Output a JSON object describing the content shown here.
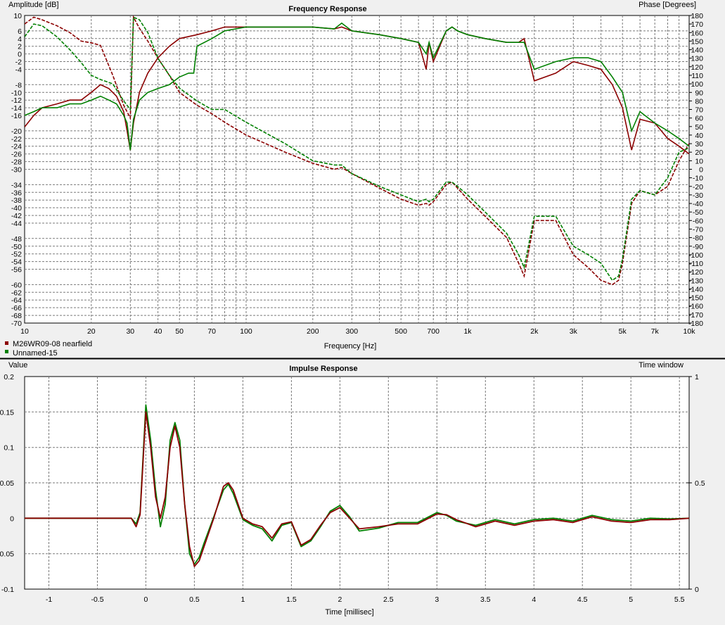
{
  "chart_data": [
    {
      "type": "line",
      "title": "Frequency Response",
      "xlabel": "Frequency [Hz]",
      "ylabel": "Amplitude [dB]",
      "y2label": "Phase [Degrees]",
      "xscale": "log",
      "xlim": [
        10,
        10000
      ],
      "ylim": [
        -70,
        10
      ],
      "y2lim": [
        -180,
        180
      ],
      "grid": true,
      "legend": "bottom-left",
      "xtick_values": [
        10,
        20,
        30,
        40,
        50,
        70,
        100,
        200,
        300,
        500,
        700,
        1000,
        2000,
        3000,
        5000,
        7000,
        10000
      ],
      "xtick_labels": [
        "10",
        "20",
        "30",
        "40",
        "50",
        "70",
        "100",
        "200",
        "300",
        "500",
        "700",
        "1k",
        "2k",
        "3k",
        "5k",
        "7k",
        "10k"
      ],
      "ytick_values": [
        10,
        6,
        4,
        2,
        0,
        -2,
        -4,
        -8,
        -10,
        -12,
        -14,
        -16,
        -20,
        -22,
        -24,
        -26,
        -28,
        -30,
        -34,
        -36,
        -38,
        -40,
        -42,
        -44,
        -48,
        -50,
        -52,
        -54,
        -56,
        -60,
        -62,
        -64,
        -66,
        -68,
        -70
      ],
      "ytick_labels": [
        "10",
        "6",
        "4",
        "2",
        "0",
        "-2",
        "-4",
        "-8",
        "-10",
        "-12",
        "-14",
        "-16",
        "-20",
        "-22",
        "-24",
        "-26",
        "-28",
        "-30",
        "-34",
        "-36",
        "-38",
        "-40",
        "-42",
        "-44",
        "-48",
        "-50",
        "-52",
        "-54",
        "-56",
        "-60",
        "-62",
        "-64",
        "-66",
        "-68",
        "-70"
      ],
      "y2tick_values": [
        180,
        170,
        160,
        150,
        140,
        130,
        120,
        110,
        100,
        90,
        80,
        70,
        60,
        50,
        40,
        30,
        20,
        10,
        0,
        -10,
        -20,
        -30,
        -40,
        -50,
        -60,
        -70,
        -80,
        -90,
        -100,
        -110,
        -120,
        -130,
        -140,
        -150,
        -160,
        -170,
        -180
      ],
      "series": [
        {
          "name": "M26WR09-08 nearfield",
          "kind": "amplitude",
          "color": "#8b0000",
          "x": [
            10,
            11,
            12,
            14,
            16,
            18,
            20,
            22,
            24,
            26,
            28,
            29,
            30,
            31,
            33,
            36,
            40,
            45,
            50,
            60,
            70,
            80,
            100,
            150,
            200,
            250,
            270,
            300,
            400,
            500,
            600,
            650,
            670,
            700,
            800,
            850,
            900,
            1000,
            1200,
            1500,
            1700,
            1800,
            2000,
            2500,
            3000,
            3500,
            4000,
            4500,
            5000,
            5500,
            6000,
            7000,
            8000,
            9000,
            10000
          ],
          "y": [
            -19,
            -16,
            -14,
            -13,
            -12,
            -12,
            -10,
            -8,
            -9,
            -11,
            -15,
            -20,
            -25,
            -18,
            -10,
            -5,
            -1,
            2,
            4,
            5,
            6,
            7,
            7,
            7,
            7,
            6.5,
            7,
            6,
            5,
            4,
            3,
            -4,
            3,
            -2,
            6,
            7,
            6,
            5,
            4,
            3,
            3,
            4,
            -7,
            -5,
            -2,
            -3,
            -4,
            -8,
            -14,
            -25,
            -17,
            -18,
            -22,
            -24,
            -26
          ]
        },
        {
          "name": "M26WR09-08 nearfield",
          "kind": "phase",
          "color": "#8b0000",
          "x": [
            10,
            11,
            12,
            14,
            16,
            18,
            20,
            22,
            25,
            28,
            30,
            31,
            33,
            36,
            40,
            45,
            50,
            60,
            70,
            80,
            100,
            150,
            200,
            250,
            270,
            300,
            400,
            500,
            600,
            650,
            670,
            700,
            800,
            850,
            900,
            1000,
            1200,
            1500,
            1700,
            1800,
            2000,
            2500,
            3000,
            3500,
            4000,
            4500,
            4800,
            5000,
            5500,
            6000,
            7000,
            8000,
            9000,
            10000
          ],
          "y": [
            170,
            178,
            175,
            168,
            160,
            150,
            148,
            145,
            110,
            75,
            60,
            178,
            165,
            150,
            130,
            110,
            90,
            75,
            65,
            55,
            40,
            20,
            7,
            0,
            2,
            -5,
            -22,
            -35,
            -42,
            -40,
            -42,
            -38,
            -18,
            -15,
            -22,
            -35,
            -55,
            -80,
            -110,
            -125,
            -60,
            -60,
            -100,
            -115,
            -130,
            -135,
            -130,
            -110,
            -40,
            -25,
            -30,
            -20,
            10,
            30
          ]
        },
        {
          "name": "Unnamed-15",
          "kind": "amplitude",
          "color": "#008000",
          "x": [
            10,
            11,
            12,
            14,
            16,
            18,
            20,
            22,
            24,
            26,
            28,
            29,
            30,
            31,
            33,
            36,
            40,
            45,
            50,
            55,
            58,
            60,
            70,
            80,
            100,
            150,
            200,
            250,
            270,
            300,
            400,
            500,
            600,
            650,
            670,
            700,
            800,
            850,
            900,
            1000,
            1200,
            1500,
            1700,
            1800,
            2000,
            2500,
            3000,
            3500,
            4000,
            4500,
            5000,
            5500,
            6000,
            7000,
            8000,
            9000,
            10000
          ],
          "y": [
            -16,
            -15,
            -14,
            -14,
            -13,
            -13,
            -12,
            -11,
            -12,
            -13,
            -16,
            -18,
            -25,
            -17,
            -12,
            -10,
            -9,
            -8,
            -6,
            -5,
            -5,
            2,
            4,
            6,
            7,
            7,
            7,
            6.5,
            8,
            6,
            5,
            4,
            3,
            0,
            3,
            -1,
            6,
            7,
            6,
            5,
            4,
            3,
            3,
            3,
            -4,
            -2,
            -1,
            -1,
            -2,
            -6,
            -10,
            -20,
            -15,
            -18,
            -20,
            -22,
            -24
          ]
        },
        {
          "name": "Unnamed-15",
          "kind": "phase",
          "color": "#008000",
          "x": [
            10,
            11,
            12,
            14,
            16,
            18,
            20,
            22,
            25,
            28,
            30,
            31,
            33,
            36,
            40,
            45,
            50,
            60,
            70,
            80,
            100,
            150,
            200,
            250,
            270,
            300,
            400,
            500,
            600,
            650,
            670,
            700,
            800,
            850,
            900,
            1000,
            1200,
            1500,
            1700,
            1800,
            2000,
            2500,
            3000,
            3500,
            4000,
            4500,
            4800,
            5000,
            5500,
            6000,
            7000,
            8000,
            9000,
            10000
          ],
          "y": [
            155,
            170,
            168,
            155,
            140,
            125,
            110,
            105,
            100,
            80,
            70,
            178,
            175,
            160,
            130,
            110,
            95,
            80,
            70,
            70,
            55,
            30,
            10,
            5,
            5,
            -5,
            -20,
            -30,
            -38,
            -35,
            -38,
            -35,
            -15,
            -15,
            -20,
            -30,
            -50,
            -75,
            -100,
            -115,
            -55,
            -55,
            -90,
            -100,
            -110,
            -130,
            -125,
            -105,
            -35,
            -25,
            -30,
            -10,
            20,
            25
          ]
        }
      ]
    },
    {
      "type": "line",
      "title": "Impulse Response",
      "xlabel": "Time [millisec]",
      "ylabel": "Value",
      "y2label": "Time window",
      "xlim": [
        -1.25,
        5.6
      ],
      "ylim": [
        -0.1,
        0.2
      ],
      "y2lim": [
        0,
        1
      ],
      "grid": true,
      "xtick_values": [
        -1,
        -0.5,
        0,
        0.5,
        1,
        1.5,
        2,
        2.5,
        3,
        3.5,
        4,
        4.5,
        5,
        5.5
      ],
      "xtick_labels": [
        "-1",
        "-0.5",
        "0",
        "0.5",
        "1",
        "1.5",
        "2",
        "2.5",
        "3",
        "3.5",
        "4",
        "4.5",
        "5",
        "5.5"
      ],
      "ytick_values": [
        0.2,
        0.15,
        0.1,
        0.05,
        0,
        -0.05,
        -0.1
      ],
      "ytick_labels": [
        "0.2",
        "0.15",
        "0.1",
        "0.05",
        "0",
        "-0.05",
        "-0.1"
      ],
      "y2tick_values": [
        1,
        0.5,
        0
      ],
      "y2tick_labels": [
        "1",
        "0.5",
        "0"
      ],
      "series": [
        {
          "name": "M26WR09-08 nearfield",
          "color": "#8b0000",
          "x": [
            -1.25,
            -0.15,
            -0.1,
            -0.06,
            0,
            0.05,
            0.1,
            0.15,
            0.2,
            0.25,
            0.3,
            0.35,
            0.4,
            0.45,
            0.5,
            0.55,
            0.6,
            0.7,
            0.8,
            0.85,
            0.9,
            1.0,
            1.1,
            1.2,
            1.3,
            1.4,
            1.5,
            1.6,
            1.7,
            1.8,
            1.9,
            2.0,
            2.1,
            2.2,
            2.4,
            2.6,
            2.8,
            3.0,
            3.1,
            3.2,
            3.4,
            3.6,
            3.8,
            4.0,
            4.2,
            4.4,
            4.6,
            4.8,
            5.0,
            5.2,
            5.4,
            5.6
          ],
          "y": [
            0,
            0,
            -0.012,
            0.005,
            0.15,
            0.1,
            0.03,
            0,
            0.03,
            0.1,
            0.13,
            0.1,
            0.02,
            -0.04,
            -0.068,
            -0.06,
            -0.04,
            0,
            0.045,
            0.05,
            0.04,
            0,
            -0.008,
            -0.012,
            -0.028,
            -0.008,
            -0.005,
            -0.038,
            -0.03,
            -0.01,
            0.008,
            0.015,
            0,
            -0.015,
            -0.012,
            -0.008,
            -0.008,
            0.006,
            0.005,
            -0.002,
            -0.012,
            -0.004,
            -0.01,
            -0.004,
            -0.002,
            -0.006,
            0.002,
            -0.004,
            -0.006,
            -0.002,
            -0.002,
            0
          ]
        },
        {
          "name": "Unnamed-15",
          "color": "#008000",
          "x": [
            -1.25,
            -0.15,
            -0.1,
            -0.06,
            0,
            0.05,
            0.1,
            0.15,
            0.2,
            0.25,
            0.3,
            0.35,
            0.4,
            0.45,
            0.5,
            0.55,
            0.6,
            0.7,
            0.8,
            0.85,
            0.9,
            1.0,
            1.1,
            1.2,
            1.3,
            1.4,
            1.5,
            1.6,
            1.7,
            1.8,
            1.9,
            2.0,
            2.1,
            2.2,
            2.4,
            2.6,
            2.8,
            3.0,
            3.1,
            3.2,
            3.4,
            3.6,
            3.8,
            4.0,
            4.2,
            4.4,
            4.6,
            4.8,
            5.0,
            5.2,
            5.4,
            5.6
          ],
          "y": [
            0,
            0,
            -0.008,
            0.008,
            0.16,
            0.11,
            0.04,
            -0.012,
            0.02,
            0.11,
            0.135,
            0.11,
            0.02,
            -0.05,
            -0.065,
            -0.055,
            -0.035,
            0.002,
            0.04,
            0.048,
            0.035,
            -0.002,
            -0.01,
            -0.015,
            -0.032,
            -0.01,
            -0.006,
            -0.04,
            -0.032,
            -0.012,
            0.01,
            0.018,
            0.002,
            -0.018,
            -0.014,
            -0.006,
            -0.006,
            0.008,
            0.004,
            -0.004,
            -0.01,
            -0.002,
            -0.008,
            -0.002,
            0,
            -0.004,
            0.004,
            -0.002,
            -0.004,
            0,
            -0.001,
            0
          ]
        }
      ]
    }
  ]
}
